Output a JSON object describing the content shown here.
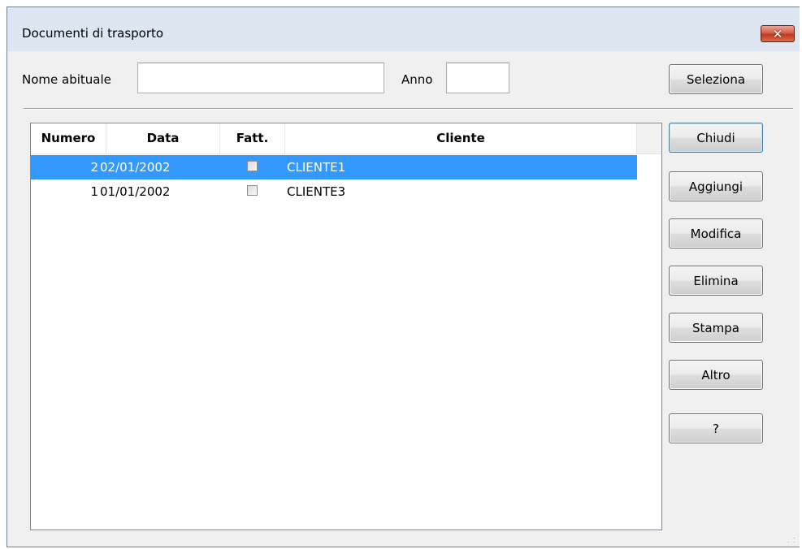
{
  "window": {
    "title": "Documenti di trasporto",
    "close_glyph": "✕"
  },
  "filter": {
    "nome_label": "Nome abituale",
    "nome_value": "",
    "anno_label": "Anno",
    "anno_value": "",
    "select_button": "Seleziona"
  },
  "table": {
    "columns": [
      "Numero",
      "Data",
      "Fatt.",
      "Cliente"
    ],
    "rows": [
      {
        "numero": "2",
        "data": "02/01/2002",
        "fatturato": false,
        "cliente": "CLIENTE1",
        "selected": true
      },
      {
        "numero": "1",
        "data": "01/01/2002",
        "fatturato": false,
        "cliente": "CLIENTE3",
        "selected": false
      }
    ]
  },
  "buttons": {
    "chiudi": "Chiudi",
    "aggiungi": "Aggiungi",
    "modifica": "Modifica",
    "elimina": "Elimina",
    "stampa": "Stampa",
    "altro": "Altro",
    "help": "?"
  },
  "colors": {
    "selection": "#3399ff",
    "window_frame": "#dde6f1",
    "client_bg": "#f0f0f0",
    "close_button": "#c7412a"
  }
}
